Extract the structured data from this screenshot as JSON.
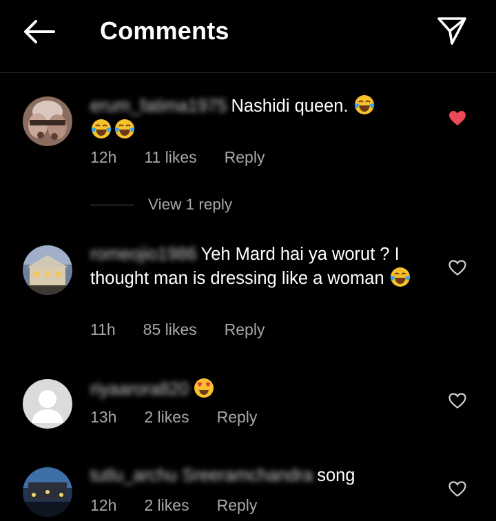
{
  "header": {
    "title": "Comments",
    "back_icon": "arrow-left-icon",
    "send_icon": "paper-plane-icon"
  },
  "comments": [
    {
      "username": "erum_fatima1975",
      "text": "Nashidi queen.",
      "time": "12h",
      "likes": "11 likes",
      "reply": "Reply",
      "liked": true,
      "view_replies": "View 1 reply"
    },
    {
      "username": "romeojio1986",
      "text": "Yeh Mard hai ya worut ? I thought man is dressing like a woman",
      "time": "11h",
      "likes": "85 likes",
      "reply": "Reply",
      "liked": false
    },
    {
      "username": "riyaarora820",
      "text": "",
      "time": "13h",
      "likes": "2 likes",
      "reply": "Reply",
      "liked": false
    },
    {
      "username": "tutlu_archu Sreeramchandra",
      "text": "song",
      "time": "12h",
      "likes": "2 likes",
      "reply": "Reply",
      "liked": false
    }
  ],
  "colors": {
    "background": "#000000",
    "secondary_text": "#a8a8a8",
    "like_red": "#ed4956"
  }
}
